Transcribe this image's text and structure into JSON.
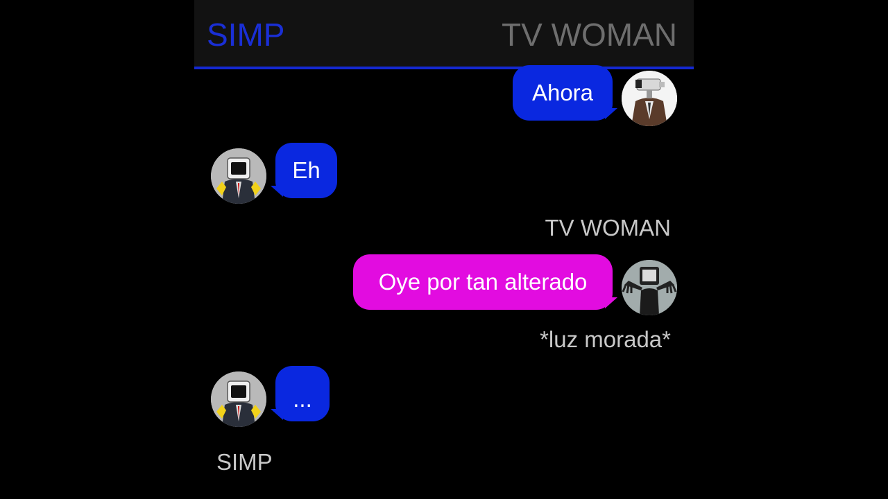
{
  "header": {
    "left_title": "SIMP",
    "right_title": "TV WOMAN"
  },
  "messages": [
    {
      "sender": "right",
      "text": "Ahora",
      "color": "#0a28e0",
      "avatar": "camera-man-avatar"
    },
    {
      "sender": "left",
      "text": "Eh",
      "color": "#0a28e0",
      "avatar": "speaker-man-avatar"
    },
    {
      "sender": "right",
      "text": "Oye por tan alterado",
      "color": "#e20ce0",
      "avatar": "tv-woman-avatar"
    },
    {
      "sender": "left",
      "text": "...",
      "color": "#0a28e0",
      "avatar": "speaker-man-avatar"
    }
  ],
  "labels": {
    "tv_woman_name": "TV WOMAN",
    "action_note": "*luz morada*",
    "simp_name": "SIMP"
  },
  "colors": {
    "accent_blue": "#1428d2",
    "bubble_blue": "#0a28e0",
    "bubble_magenta": "#e20ce0",
    "header_bg": "#121212"
  }
}
